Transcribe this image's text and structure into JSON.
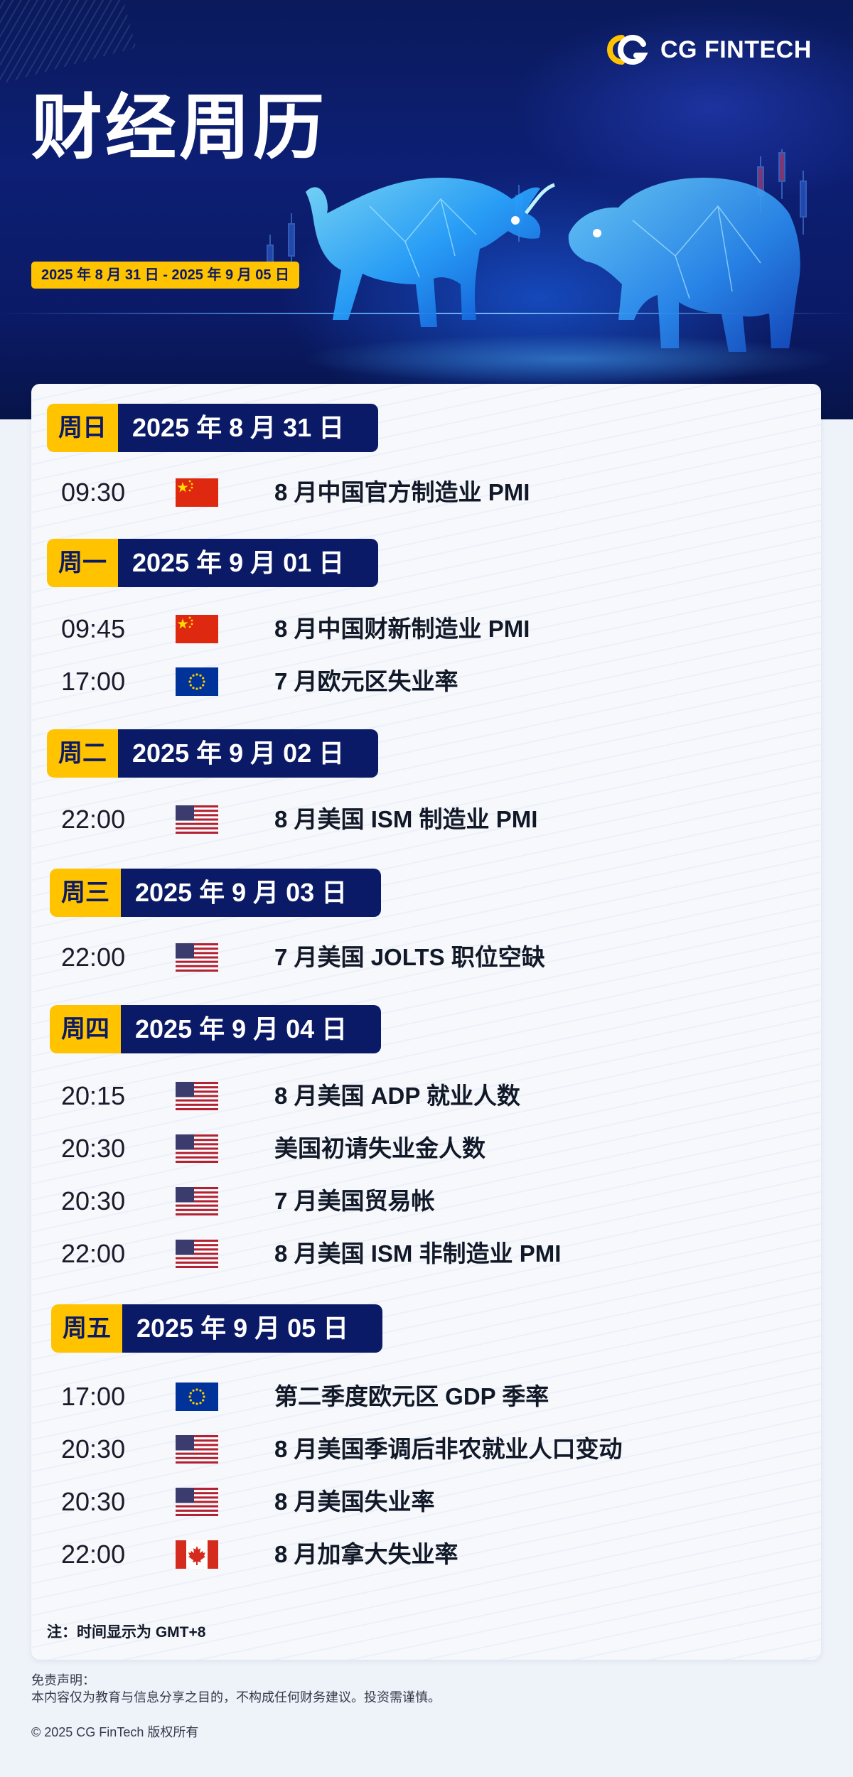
{
  "brand": {
    "name": "CG FINTECH"
  },
  "header": {
    "title": "财经周历",
    "date_range": "2025 年 8 月 31 日 - 2025 年 9 月 05 日"
  },
  "days": [
    {
      "weekday": "周日",
      "date": "2025 年 8 月 31 日",
      "events": [
        {
          "time": "09:30",
          "flag": "CN",
          "title": "8 月中国官方制造业 PMI"
        }
      ]
    },
    {
      "weekday": "周一",
      "date": "2025 年 9 月 01 日",
      "events": [
        {
          "time": "09:45",
          "flag": "CN",
          "title": "8 月中国财新制造业 PMI"
        },
        {
          "time": "17:00",
          "flag": "EU",
          "title": "7 月欧元区失业率"
        }
      ]
    },
    {
      "weekday": "周二",
      "date": "2025 年 9 月 02 日",
      "events": [
        {
          "time": "22:00",
          "flag": "US",
          "title": "8 月美国 ISM 制造业 PMI"
        }
      ]
    },
    {
      "weekday": "周三",
      "date": "2025 年 9 月 03 日",
      "events": [
        {
          "time": "22:00",
          "flag": "US",
          "title": "7 月美国 JOLTS 职位空缺"
        }
      ]
    },
    {
      "weekday": "周四",
      "date": "2025 年 9 月 04 日",
      "events": [
        {
          "time": "20:15",
          "flag": "US",
          "title": "8 月美国 ADP 就业人数"
        },
        {
          "time": "20:30",
          "flag": "US",
          "title": "美国初请失业金人数"
        },
        {
          "time": "20:30",
          "flag": "US",
          "title": "7 月美国贸易帐"
        },
        {
          "time": "22:00",
          "flag": "US",
          "title": "8 月美国 ISM 非制造业 PMI"
        }
      ]
    },
    {
      "weekday": "周五",
      "date": "2025 年 9 月 05 日",
      "events": [
        {
          "time": "17:00",
          "flag": "EU",
          "title": "第二季度欧元区 GDP 季率"
        },
        {
          "time": "20:30",
          "flag": "US",
          "title": "8 月美国季调后非农就业人口变动"
        },
        {
          "time": "20:30",
          "flag": "US",
          "title": "8 月美国失业率"
        },
        {
          "time": "22:00",
          "flag": "CA",
          "title": "8 月加拿大失业率"
        }
      ]
    }
  ],
  "note": "注：时间显示为 GMT+8",
  "footer": {
    "disclaimer_title": "免责声明：",
    "disclaimer_text": "本内容仅为教育与信息分享之目的，不构成任何财务建议。投资需谨慎。",
    "copyright": "© 2025 CG FinTech 版权所有"
  },
  "colors": {
    "navy": "#0b1a66",
    "gold": "#ffc300",
    "bull_glow": "#3fb8ff"
  }
}
